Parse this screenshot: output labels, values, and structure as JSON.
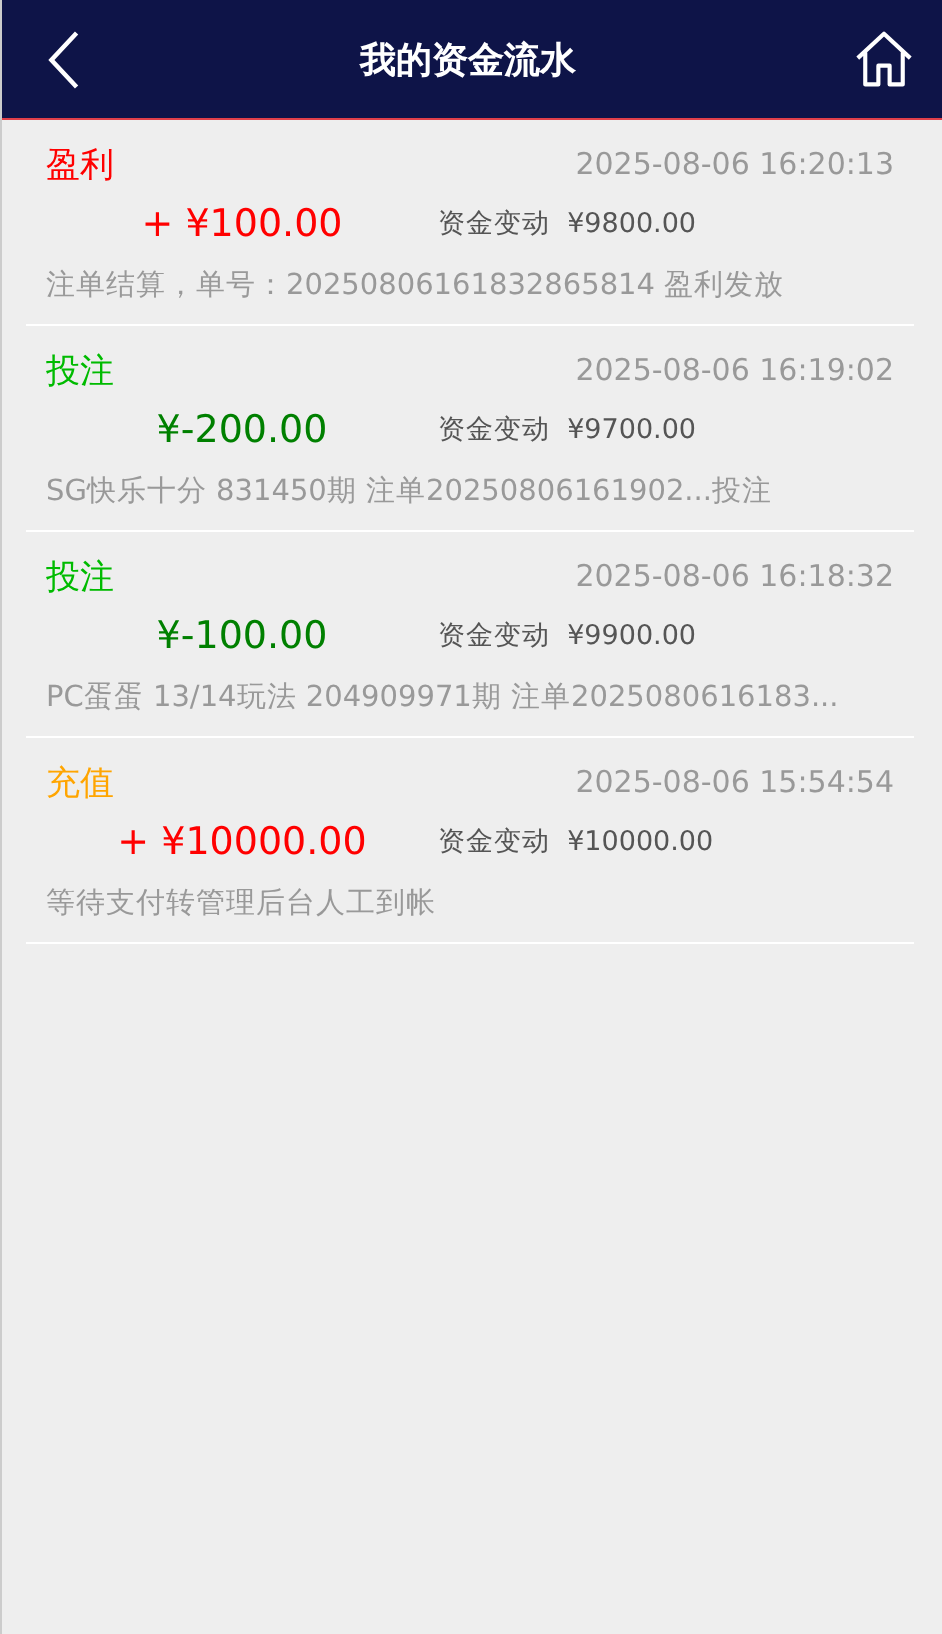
{
  "header": {
    "title": "我的资金流水"
  },
  "records": [
    {
      "type": "盈利",
      "color": "#ff0000",
      "kind": "income",
      "time": "2025-08-06 16:20:13",
      "amount": "+ ¥100.00",
      "change_label": "资金变动",
      "balance": "¥9800.00",
      "note": "注单结算，单号：20250806161832865814 盈利发放"
    },
    {
      "type": "投注",
      "color": "#00bb00",
      "kind": "expense",
      "time": "2025-08-06 16:19:02",
      "amount": "¥-200.00",
      "change_label": "资金变动",
      "balance": "¥9700.00",
      "note": "SG快乐十分 831450期 注单20250806161902...投注"
    },
    {
      "type": "投注",
      "color": "#00bb00",
      "kind": "expense",
      "time": "2025-08-06 16:18:32",
      "amount": "¥-100.00",
      "change_label": "资金变动",
      "balance": "¥9900.00",
      "note": "PC蛋蛋 13/14玩法 204909971期 注单2025080616183..."
    },
    {
      "type": "充值",
      "color": "#ffa500",
      "kind": "income",
      "time": "2025-08-06 15:54:54",
      "amount": "+ ¥10000.00",
      "change_label": "资金变动",
      "balance": "¥10000.00",
      "note": "等待支付转管理后台人工到帐"
    }
  ]
}
